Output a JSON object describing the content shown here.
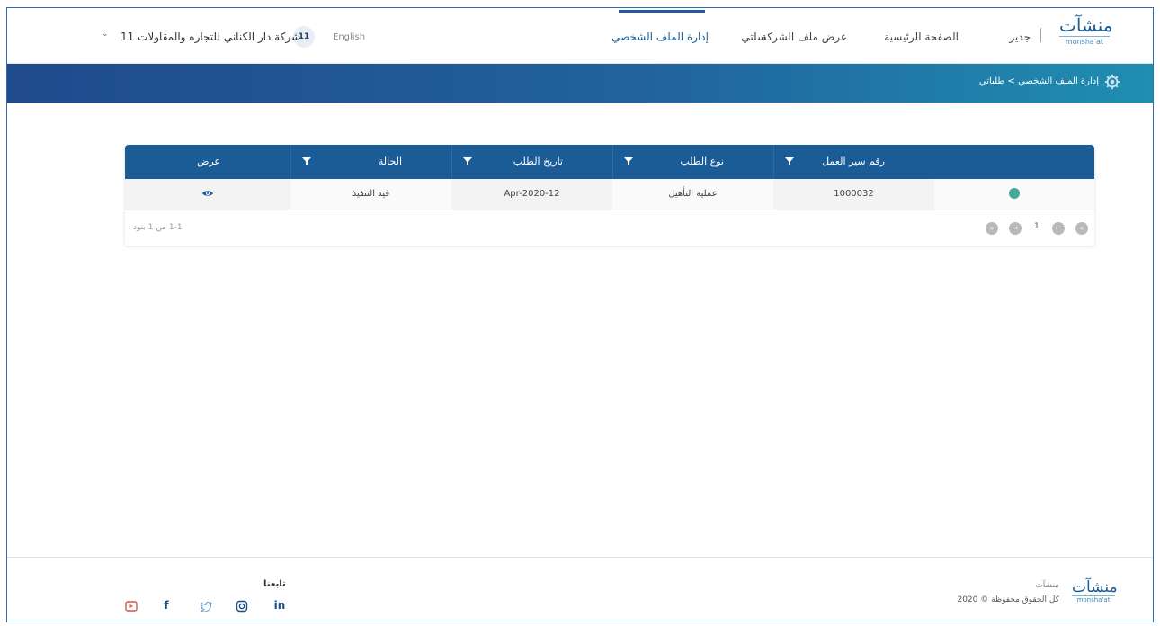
{
  "header": {
    "logo_ar": "منشآت",
    "logo_en": "monsha'at",
    "jadeer": "جدير",
    "nav": [
      {
        "label": "الصفحة الرئيسية"
      },
      {
        "label": "عرض ملف الشركة"
      },
      {
        "label": "سلتي"
      },
      {
        "label": "إدارة الملف الشخصي",
        "active": true
      }
    ],
    "company_name": "شركة دار الكناني للتجاره والمقاولات 11",
    "badge": "11",
    "language": "English"
  },
  "breadcrumb": "إدارة الملف الشخصي > طلباتي",
  "table": {
    "columns": [
      {
        "label": "رقم سير العمل"
      },
      {
        "label": "نوع الطلب"
      },
      {
        "label": "تاريخ الطلب"
      },
      {
        "label": "الحالة"
      },
      {
        "label": "عرض"
      }
    ],
    "rows": [
      {
        "workflow_no": "1000032",
        "type": "عملية التأهيل",
        "date": "Apr-2020-12",
        "status": "قيد التنفيذ",
        "view": "eye-icon"
      }
    ],
    "pager": {
      "page": "1",
      "info": "1-1 من 1 بنود"
    }
  },
  "footer": {
    "logo_ar": "منشآت",
    "logo_en": "monsha'at",
    "name": "منشآت",
    "copyright": "كل الحقوق محفوظة © 2020",
    "follow_label": "تابعنا",
    "social": [
      "linkedin-icon",
      "instagram-icon",
      "twitter-icon",
      "facebook-icon",
      "youtube-icon"
    ]
  },
  "colors": {
    "primary": "#1b5b96",
    "accent": "#1f8eb0",
    "dot": "#45a99a"
  }
}
